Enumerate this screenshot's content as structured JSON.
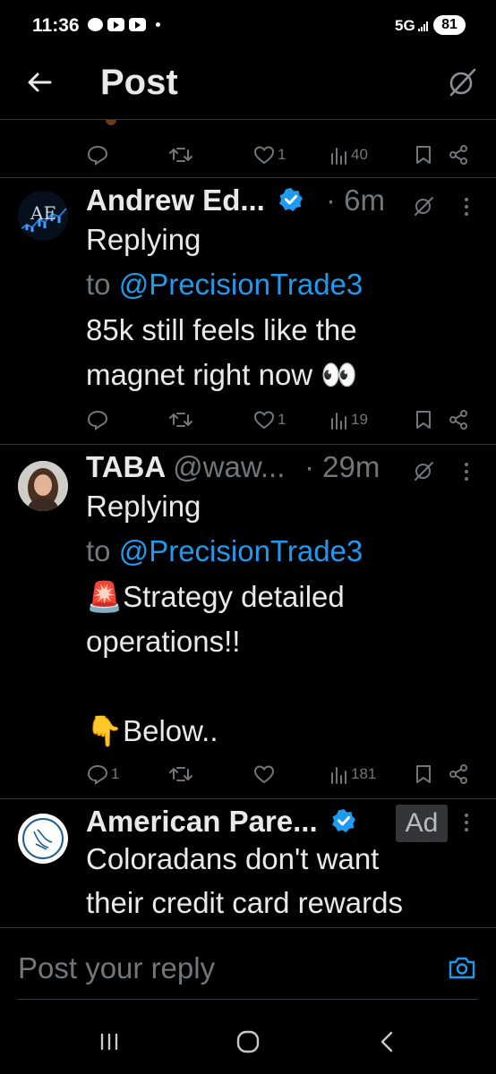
{
  "status_bar": {
    "time": "11:36",
    "network": "5G",
    "battery": "81"
  },
  "header": {
    "title": "Post"
  },
  "first_actions": {
    "likes": "1",
    "views": "40"
  },
  "replies": [
    {
      "name": "Andrew Ed...",
      "handle": "",
      "time": "· 6m",
      "verified": true,
      "replying_word": "Replying",
      "replying_to_prefix": "to ",
      "replying_to_handle": "@PrecisionTrade3",
      "text_lines": [
        "85k still feels like the",
        "magnet right now 👀"
      ],
      "actions": {
        "replies": "",
        "likes": "1",
        "views": "19"
      }
    },
    {
      "name": "TABA",
      "handle": "@waw...",
      "time": "· 29m",
      "verified": false,
      "replying_word": "Replying",
      "replying_to_prefix": "to ",
      "replying_to_handle": "@PrecisionTrade3",
      "text_lines": [
        "🚨Strategy detailed",
        "operations!!",
        "",
        "👇Below.."
      ],
      "actions": {
        "replies": "1",
        "likes": "",
        "views": "181"
      }
    },
    {
      "name": "American Pare...",
      "verified": true,
      "ad_label": "Ad",
      "text_lines": [
        "Coloradans don't want",
        "their credit card rewards"
      ]
    }
  ],
  "reply_bar": {
    "placeholder": "Post your reply"
  },
  "colors": {
    "background": "#000000",
    "text": "#e7e9ea",
    "muted": "#71767b",
    "accent": "#1d9bf0",
    "divider": "#2f3336"
  }
}
